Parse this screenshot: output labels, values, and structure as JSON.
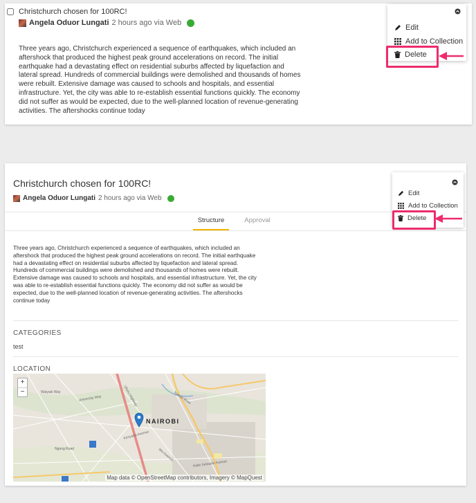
{
  "top": {
    "checkbox_checked": false,
    "title": "Christchurch chosen for 100RC!",
    "author": "Angela Oduor Lungati",
    "meta": "2 hours ago via Web",
    "description": "Three years ago, Christchurch experienced a sequence of earthquakes, which included an aftershock that produced the highest peak ground accelerations on record. The initial earthquake had a devastating effect on residential suburbs affected by liquefaction and lateral spread. Hundreds of commercial buildings were demolished and thousands of homes were rebuilt. Extensive damage was caused to schools and hospitals, and essential infrastructure. Yet, the city was able to re-establish essential functions quickly. The economy did not suffer as would be expected, due to the well-planned location of revenue-generating activities. The aftershocks continue today",
    "menu": {
      "edit": "Edit",
      "add_to_collection": "Add to Collection",
      "delete": "Delete"
    }
  },
  "bottom": {
    "title": "Christchurch chosen for 100RC!",
    "author": "Angela Oduor Lungati",
    "meta": "2 hours ago via Web",
    "tabs": [
      {
        "label": "Structure",
        "active": true
      },
      {
        "label": "Approval",
        "active": false
      }
    ],
    "description": "Three years ago, Christchurch experienced a sequence of earthquakes, which included an aftershock that produced the highest peak ground accelerations on record. The initial earthquake had a devastating effect on residential suburbs affected by liquefaction and lateral spread. Hundreds of commercial buildings were demolished and thousands of homes were rebuilt. Extensive damage was caused to schools and hospitals, and essential infrastructure. Yet, the city was able to re-establish essential functions quickly. The economy did not suffer as would be expected, due to the well-planned location of revenue-generating activities. The aftershocks continue today",
    "categories_heading": "CATEGORIES",
    "categories_value": "test",
    "location_heading": "LOCATION",
    "map": {
      "zoom_in": "+",
      "zoom_out": "−",
      "city_label": "NAIROBI",
      "attribution": "Map data © OpenStreetMap contributors, Imagery © MapQuest",
      "street_labels": [
        "Uhuru Highway",
        "Haile Selassie Avenue",
        "Moi Avenue",
        "Nairobi River",
        "Waiyaki Way",
        "Ngong Road",
        "University Way",
        "Kenyatta Avenue"
      ]
    },
    "menu": {
      "edit": "Edit",
      "add_to_collection": "Add to Collection",
      "delete": "Delete"
    }
  },
  "colors": {
    "highlight": "#ec2c6e",
    "tab_underline": "#f5b400",
    "pin": "#2a7ac9",
    "status_green": "#3aaa35"
  },
  "icons": [
    "checkbox-icon",
    "avatar-icon",
    "web-source-icon",
    "chevron-up-icon",
    "pencil-icon",
    "grid-icon",
    "trash-icon",
    "arrow-icon",
    "map-pin-icon"
  ]
}
